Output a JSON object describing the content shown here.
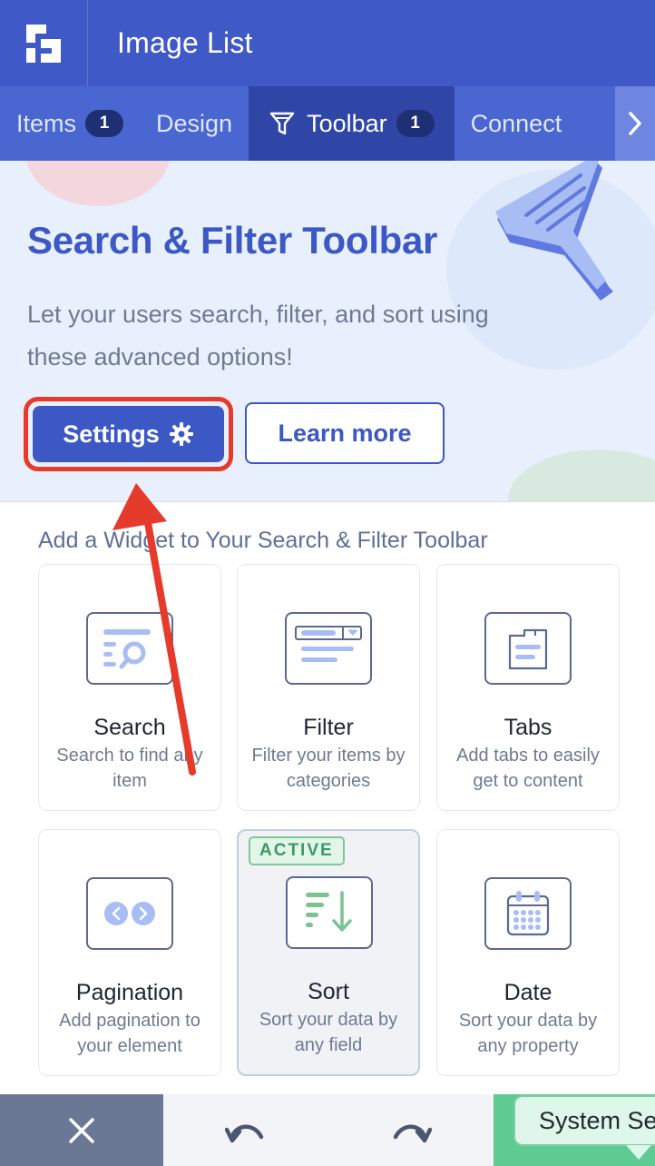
{
  "header": {
    "title": "Image List",
    "logo_icon": "app-logo-icon"
  },
  "tabs": [
    {
      "label": "Items",
      "badge": "1"
    },
    {
      "label": "Design"
    },
    {
      "label": "Toolbar",
      "badge": "1",
      "icon": "filter-icon",
      "active": true
    },
    {
      "label": "Connect"
    }
  ],
  "hero": {
    "title": "Search & Filter Toolbar",
    "description": "Let your users search, filter, and sort using these advanced options!",
    "settings_label": "Settings",
    "learn_more_label": "Learn more"
  },
  "widgets": {
    "heading": "Add a Widget to Your Search & Filter Toolbar",
    "items": [
      {
        "title": "Search",
        "desc": "Search to find any item",
        "icon": "search-widget-icon"
      },
      {
        "title": "Filter",
        "desc": "Filter your items by categories",
        "icon": "filter-widget-icon"
      },
      {
        "title": "Tabs",
        "desc": "Add tabs to easily get to content",
        "icon": "tabs-widget-icon"
      },
      {
        "title": "Pagination",
        "desc": "Add pagination to your element",
        "icon": "pagination-widget-icon"
      },
      {
        "title": "Sort",
        "desc": "Sort your data by any field",
        "icon": "sort-widget-icon",
        "badge": "ACTIVE"
      },
      {
        "title": "Date",
        "desc": "Sort your data by any property",
        "icon": "calendar-widget-icon"
      }
    ]
  },
  "bottombar": {
    "tooltip": "System Se"
  },
  "colors": {
    "primary": "#3c58c4",
    "header": "#3f59c7",
    "active_tab": "#2f46a6",
    "annotation": "#e63a2b",
    "active_badge": "#3c9a64"
  }
}
